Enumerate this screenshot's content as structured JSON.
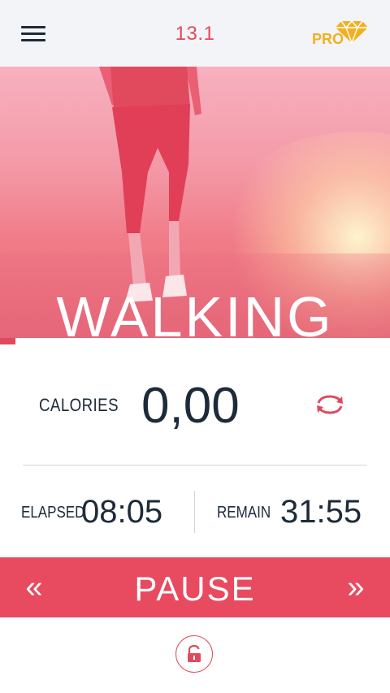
{
  "header": {
    "title": "13.1",
    "pro_label": "PRO",
    "menu_icon": "hamburger-menu-icon",
    "pro_icon": "diamond-icon"
  },
  "hero": {
    "activity": "WALKING",
    "progress": 0.04
  },
  "stats": {
    "calories_label": "CALORIES",
    "calories_value": "0,00",
    "refresh_icon": "refresh-icon",
    "elapsed_label": "ELAPSED",
    "elapsed_value": "08:05",
    "remain_label": "REMAIN",
    "remain_value": "31:55"
  },
  "controls": {
    "pause_label": "PAUSE",
    "prev_label": "«",
    "next_label": "»",
    "lock_icon": "unlock-icon"
  },
  "colors": {
    "accent": "#e84a5f",
    "pro": "#f2b020",
    "text": "#1d2a3a"
  }
}
